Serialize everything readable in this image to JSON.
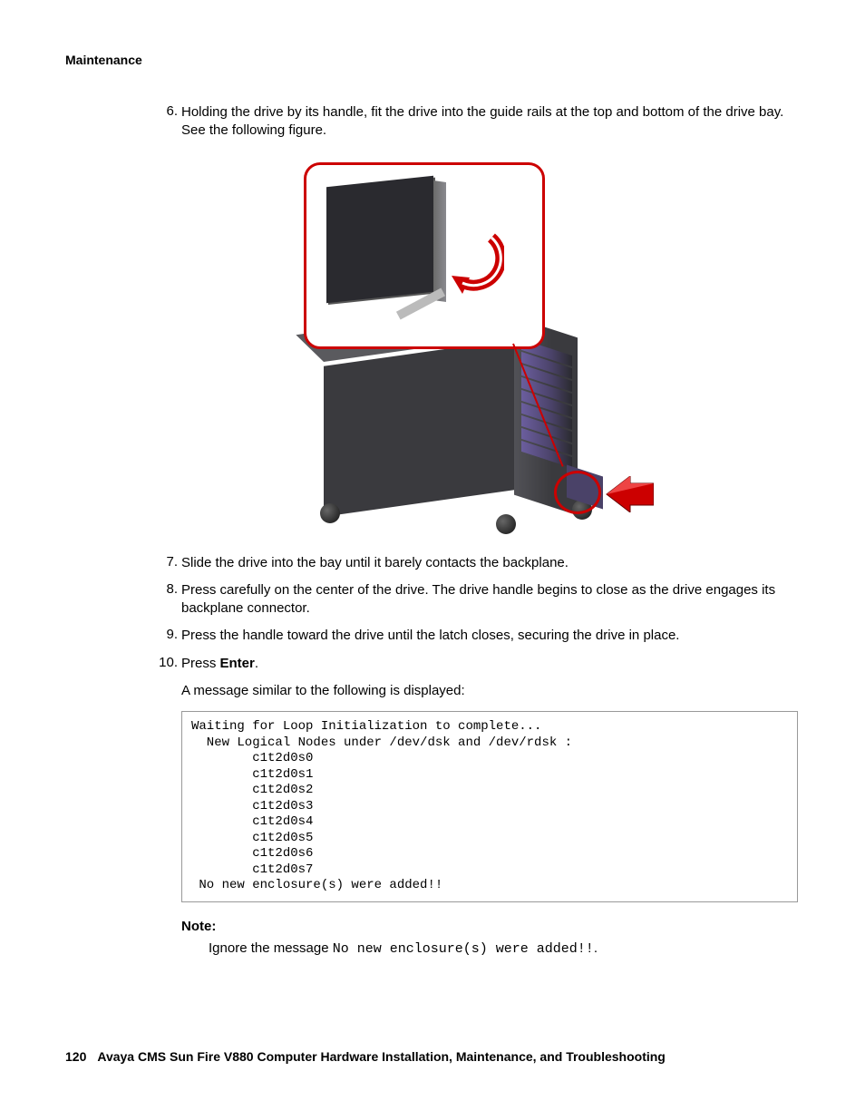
{
  "header": {
    "section": "Maintenance"
  },
  "steps": {
    "s6": {
      "num": "6.",
      "text_a": "Holding the drive by its handle, fit the drive into the guide rails at the top and bottom of the drive bay. See the following figure."
    },
    "s7": {
      "num": "7.",
      "text": "Slide the drive into the bay until it barely contacts the backplane."
    },
    "s8": {
      "num": "8.",
      "text": "Press carefully on the center of the drive. The drive handle begins to close as the drive engages its backplane connector."
    },
    "s9": {
      "num": "9.",
      "text": "Press the handle toward the drive until the latch closes, securing the drive in place."
    },
    "s10": {
      "num": "10.",
      "text_a": "Press ",
      "text_b": "Enter",
      "text_c": ".",
      "sub": "A message similar to the following is displayed:"
    }
  },
  "code": "Waiting for Loop Initialization to complete...\n  New Logical Nodes under /dev/dsk and /dev/rdsk :\n        c1t2d0s0\n        c1t2d0s1\n        c1t2d0s2\n        c1t2d0s3\n        c1t2d0s4\n        c1t2d0s5\n        c1t2d0s6\n        c1t2d0s7\n No new enclosure(s) were added!!",
  "note": {
    "label": "Note:",
    "body_a": "Ignore the message ",
    "body_mono": "No new enclosure(s) were added!!",
    "body_b": "."
  },
  "footer": {
    "page": "120",
    "title": "Avaya CMS Sun Fire V880 Computer Hardware Installation, Maintenance, and Troubleshooting"
  }
}
